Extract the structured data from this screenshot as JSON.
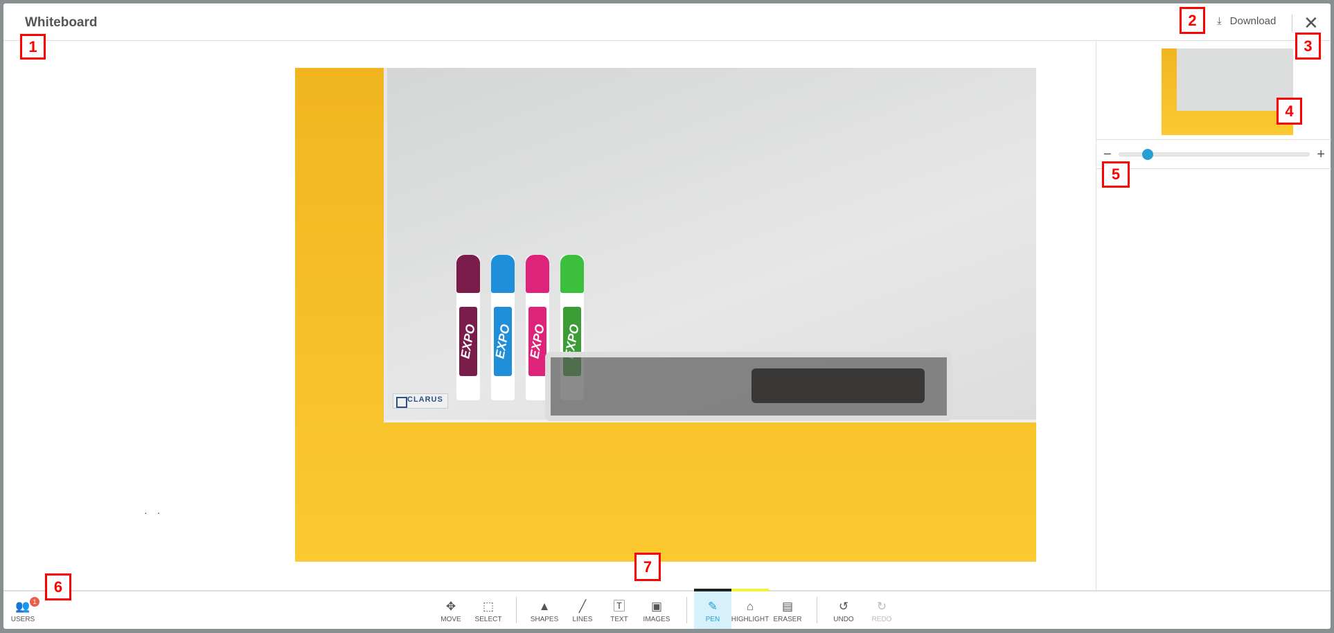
{
  "header": {
    "title": "Whiteboard",
    "download_label": "Download",
    "close_icon": "close-icon",
    "download_icon": "download-icon"
  },
  "zoom": {
    "minus": "−",
    "plus": "+",
    "level_fraction": 0.15,
    "accent": "#239fd3"
  },
  "canvas": {
    "photo_brand": "CLARUS",
    "marker_brand": "EXPO"
  },
  "toolbar": {
    "users": {
      "label": "USERS",
      "count": "1"
    },
    "tools": [
      {
        "label": "MOVE",
        "icon": "move-icon",
        "glyph": "✥"
      },
      {
        "label": "SELECT",
        "icon": "select-icon",
        "glyph": "⬚"
      },
      {
        "label": "SHAPES",
        "icon": "shapes-icon",
        "glyph": "▲"
      },
      {
        "label": "LINES",
        "icon": "line-icon",
        "glyph": "╱"
      },
      {
        "label": "TEXT",
        "icon": "text-icon",
        "glyph": "🅃"
      },
      {
        "label": "IMAGES",
        "icon": "image-icon",
        "glyph": "▣"
      },
      {
        "label": "PEN",
        "icon": "pen-icon",
        "glyph": "✎",
        "active": true,
        "color": "#222222"
      },
      {
        "label": "HIGHLIGHT",
        "icon": "highlighter-icon",
        "glyph": "⌂",
        "color": "#f5f03a"
      },
      {
        "label": "ERASER",
        "icon": "eraser-icon",
        "glyph": "▤"
      },
      {
        "label": "UNDO",
        "icon": "undo-icon",
        "glyph": "↺"
      },
      {
        "label": "REDO",
        "icon": "redo-icon",
        "glyph": "↻",
        "disabled": true
      }
    ]
  },
  "annotations": [
    "1",
    "2",
    "3",
    "4",
    "5",
    "6",
    "7"
  ]
}
